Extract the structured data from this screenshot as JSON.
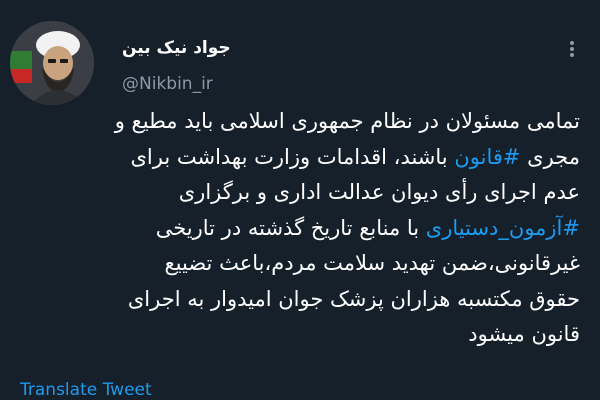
{
  "author": {
    "name": "جواد نیک بین",
    "handle": "@Nikbin_ir"
  },
  "tweet": {
    "line1": "تمامی مسئولان در نظام جمهوری اسلامی باید مطیع و",
    "line2_pre": "مجری ",
    "line2_tag": "#قانون",
    "line2_post": " باشند، اقدامات وزارت بهداشت برای",
    "line3": "عدم اجرای رأی دیوان عدالت اداری و برگزاری",
    "line4_tag": "#آزمون_دستیاری",
    "line4_post": " با منابع تاریخ گذشته در تاریخی",
    "line5": "غیرقانونی،ضمن تهدید سلامت مردم،باعث تضییع",
    "line6": "حقوق مکتسبه هزاران پزشک جوان امیدوار به اجرای",
    "line7": "قانون میشود"
  },
  "actions": {
    "translate_label": "Translate Tweet",
    "more_icon": "more-vertical-icon"
  },
  "colors": {
    "background": "#15202b",
    "link": "#1d9bf0",
    "secondary_text": "#8b98a5"
  }
}
